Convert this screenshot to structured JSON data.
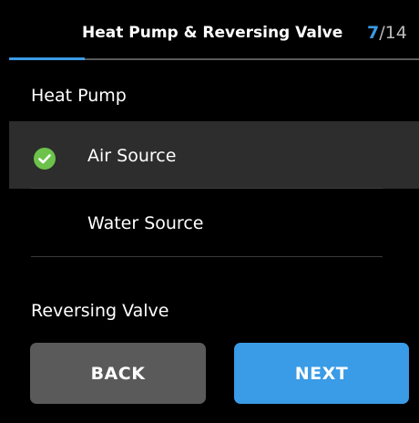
{
  "header": {
    "title": "Heat Pump & Reversing Valve",
    "step_current": "7",
    "step_separator_total": "/14"
  },
  "progress": {
    "current_step": 7,
    "total_steps": 14
  },
  "sections": {
    "heat_pump_label": "Heat Pump",
    "reversing_valve_label": "Reversing Valve"
  },
  "heat_pump_options": [
    {
      "label": "Air Source",
      "selected": true
    },
    {
      "label": "Water Source",
      "selected": false
    }
  ],
  "buttons": {
    "back_label": "BACK",
    "next_label": "NEXT"
  },
  "colors": {
    "accent": "#3a9be6",
    "check": "#6cc24a",
    "selected_row": "#2d2d2d",
    "back_button": "#5a5a5a",
    "background": "#000000"
  },
  "icons": {
    "selected_option": "check-circle-icon"
  }
}
